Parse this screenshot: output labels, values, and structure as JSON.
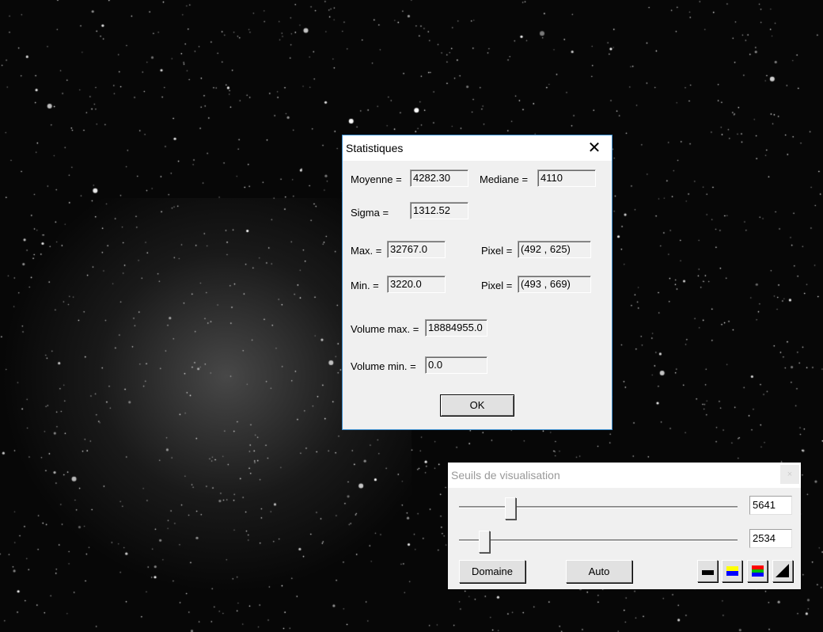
{
  "stats_dialog": {
    "title": "Statistiques",
    "close_glyph": "✕",
    "moyenne_label": "Moyenne =",
    "moyenne": "4282.30",
    "mediane_label": "Mediane =",
    "mediane": "4110",
    "sigma_label": "Sigma =",
    "sigma": "1312.52",
    "max_label": "Max. =",
    "max": "32767.0",
    "max_pixel_label": "Pixel =",
    "max_pixel": "(492 , 625)",
    "min_label": "Min. =",
    "min": "3220.0",
    "min_pixel_label": "Pixel =",
    "min_pixel": "(493 , 669)",
    "volume_max_label": "Volume max. =",
    "volume_max": "18884955.0",
    "volume_min_label": "Volume min. =",
    "volume_min": "0.0",
    "ok_label": "OK"
  },
  "seuils_panel": {
    "title": "Seuils de visualisation",
    "close_glyph": "×",
    "high_value": "5641",
    "high_slider_fraction": 0.185,
    "low_value": "2534",
    "low_slider_fraction": 0.09,
    "domaine_label": "Domaine",
    "auto_label": "Auto",
    "palette_buttons": [
      "gray-palette-icon",
      "yellow-blue-palette-icon",
      "rgb-palette-icon",
      "gradient-ramp-icon"
    ],
    "colors": {
      "yellow": "#ffff00",
      "blue": "#0000ff",
      "red": "#ff0000",
      "green": "#00c000",
      "black": "#000000"
    }
  }
}
